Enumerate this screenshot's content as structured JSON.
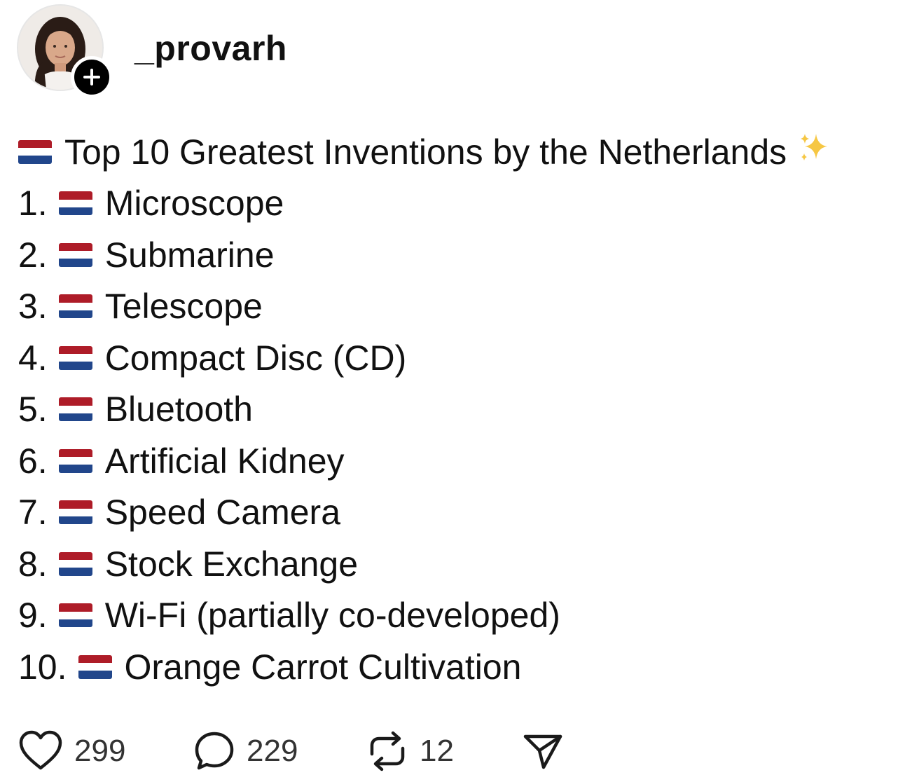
{
  "post": {
    "username": "_provarh",
    "title": "Top 10 Greatest Inventions by the Netherlands",
    "items": [
      {
        "number": "1.",
        "label": "Microscope"
      },
      {
        "number": "2.",
        "label": "Submarine"
      },
      {
        "number": "3.",
        "label": "Telescope"
      },
      {
        "number": "4.",
        "label": "Compact Disc (CD)"
      },
      {
        "number": "5.",
        "label": "Bluetooth"
      },
      {
        "number": "6.",
        "label": "Artificial Kidney"
      },
      {
        "number": "7.",
        "label": "Speed Camera"
      },
      {
        "number": "8.",
        "label": "Stock Exchange"
      },
      {
        "number": "9.",
        "label": "Wi-Fi (partially co-developed)"
      },
      {
        "number": "10.",
        "label": "Orange Carrot Cultivation"
      }
    ]
  },
  "actions": {
    "likes": "299",
    "comments": "229",
    "reposts": "12"
  },
  "icons": {
    "flag": "netherlands-flag-icon",
    "title_emoji": "sparkles-icon",
    "follow": "plus-icon",
    "like": "heart-icon",
    "comment": "comment-bubble-icon",
    "repost": "repost-icon",
    "share": "send-icon"
  },
  "colors": {
    "flag_red": "#ae1c28",
    "flag_white": "#ffffff",
    "flag_blue": "#21468b",
    "sparkle": "#f6c744",
    "text": "#111111"
  }
}
